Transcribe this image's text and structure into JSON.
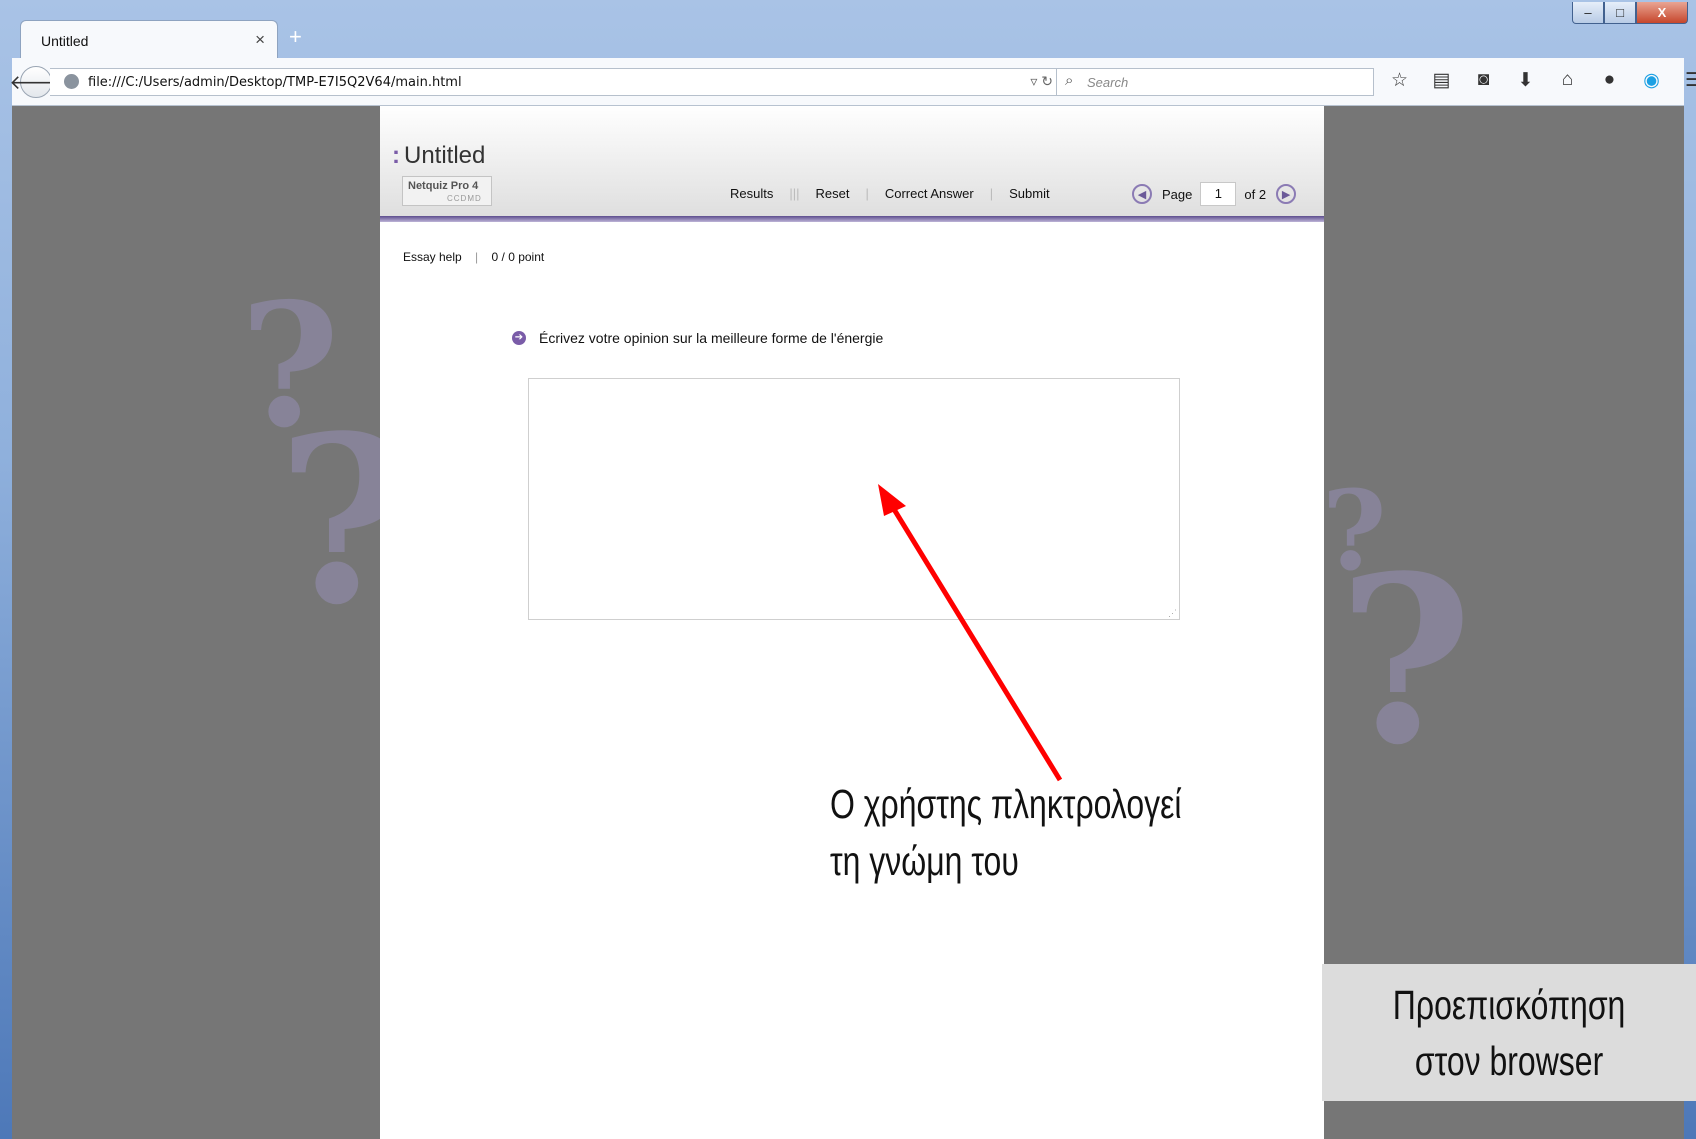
{
  "browser": {
    "tab_title": "Untitled",
    "tab_close": "×",
    "new_tab": "+",
    "url": "file:///C:/Users/admin/Desktop/TMP-E7I5Q2V64/main.html",
    "search_placeholder": "Search",
    "window_buttons": {
      "minimize": "–",
      "maximize": "□",
      "close": "X"
    }
  },
  "quiz": {
    "title": "Untitled",
    "logo_name": "Netquiz Pro 4",
    "logo_sub": "CCDMD",
    "menu": {
      "results": "Results",
      "reset": "Reset",
      "correct_answer": "Correct Answer",
      "submit": "Submit"
    },
    "pager": {
      "label": "Page",
      "current": "1",
      "of_label": "of 2"
    },
    "help": {
      "essay_help": "Essay help",
      "points": "0 / 0 point"
    },
    "question": "Écrivez votre opinion sur la meilleure forme de l'énergie",
    "answer_value": ""
  },
  "annotation": {
    "line1": "Ο χρήστης πληκτρολογεί",
    "line2": "τη γνώμη του",
    "arrow_color": "#ff0000"
  },
  "preview_label": {
    "line1": "Προεπισκόπηση",
    "line2": "στον browser"
  },
  "colors": {
    "accent": "#7a5ca8",
    "stripe": "#5d4d8e",
    "backdrop": "#767676"
  }
}
